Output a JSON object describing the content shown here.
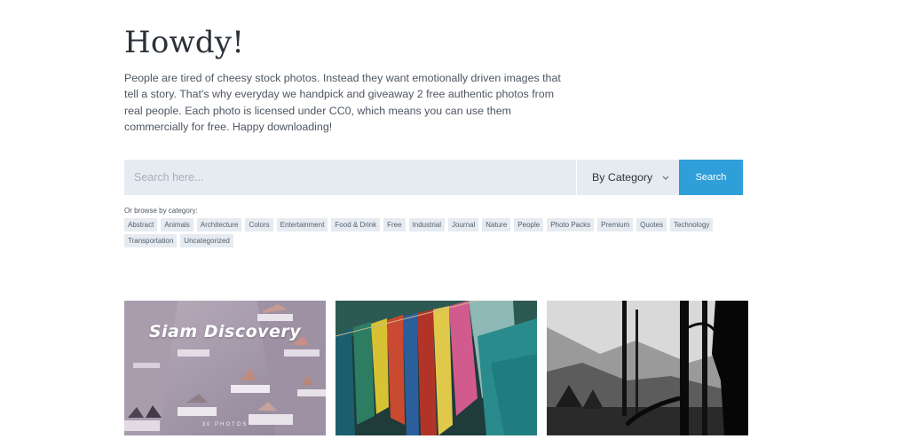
{
  "intro": {
    "heading": "Howdy!",
    "paragraph": "People are tired of cheesy stock photos. Instead they want emotionally driven images that tell a story. That's why everyday we handpick and giveaway 2 free authentic photos from real people. Each photo is licensed under CC0, which means you can use them commercially for free. Happy downloading!"
  },
  "search": {
    "placeholder": "Search here...",
    "category_label": "By Category",
    "button_label": "Search"
  },
  "browse": {
    "label": "Or browse by category:",
    "tags": [
      "Abstract",
      "Animals",
      "Architecture",
      "Colors",
      "Entertainment",
      "Food & Drink",
      "Free",
      "Industrial",
      "Journal",
      "Nature",
      "People",
      "Photo Packs",
      "Premium",
      "Quotes",
      "Technology",
      "Transportation",
      "Uncategorized"
    ]
  },
  "photos": [
    {
      "title": "Siam Discovery",
      "subtitle": "30 PHOTOS"
    },
    {
      "title": ""
    },
    {
      "title": ""
    }
  ],
  "colors": {
    "accent": "#2f9fd9",
    "field_bg": "#e5ebf1"
  }
}
